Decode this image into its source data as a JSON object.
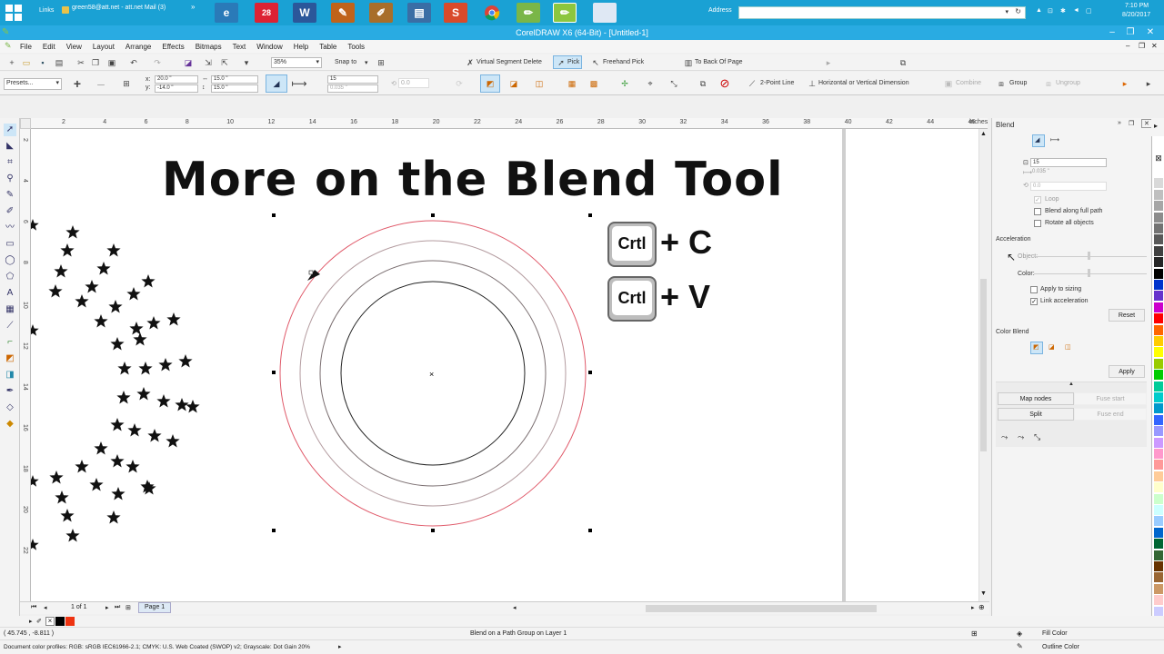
{
  "taskbar": {
    "links_label": "Links",
    "mail_label": "green58@att.net - att.net Mail (3)",
    "address_label": "Address",
    "time": "7:10 PM",
    "date": "8/20/2017"
  },
  "window": {
    "title": "CorelDRAW X6 (64-Bit) - [Untitled-1]"
  },
  "menu": [
    "File",
    "Edit",
    "View",
    "Layout",
    "Arrange",
    "Effects",
    "Bitmaps",
    "Text",
    "Window",
    "Help",
    "Table",
    "Tools"
  ],
  "toolbar": {
    "zoom": "35%",
    "snap_to": "Snap to",
    "virtual_segment_delete": "Virtual Segment Delete",
    "pick": "Pick",
    "freehand_pick": "Freehand Pick",
    "to_back_of_page": "To Back Of Page"
  },
  "property_bar": {
    "presets": "Presets...",
    "x": "20.0 \"",
    "y": "-14.0 \"",
    "width": "15.0 \"",
    "height": "15.0 \"",
    "steps": "15",
    "spacing": "0.035 \"",
    "angle": "0.0",
    "two_point_line": "2-Point Line",
    "horiz_vert_dimension": "Horizontal or Vertical Dimension",
    "combine": "Combine",
    "group": "Group",
    "ungroup": "Ungroup"
  },
  "rulers": {
    "h_ticks": [
      "2",
      "4",
      "6",
      "8",
      "10",
      "12",
      "14",
      "16",
      "18",
      "20",
      "22",
      "24",
      "26",
      "28",
      "30",
      "32",
      "34",
      "36",
      "38",
      "40",
      "42",
      "44",
      "46"
    ],
    "h_unit": "inches",
    "v_ticks": [
      "2",
      "4",
      "6",
      "8",
      "10",
      "12",
      "14",
      "16",
      "18",
      "20",
      "22"
    ]
  },
  "canvas": {
    "title": "More on the Blend Tool",
    "shortcut1_key": "Crtl",
    "shortcut1_plus": "+ C",
    "shortcut2_key": "Crtl",
    "shortcut2_plus": "+ V"
  },
  "docker": {
    "title": "Blend",
    "steps": "15",
    "spacing": "0.035 \"",
    "rotation": "0.0",
    "loop": "Loop",
    "blend_along_full_path": "Blend along full path",
    "rotate_all_objects": "Rotate all objects",
    "acceleration_label": "Acceleration",
    "object_label": "Object:",
    "color_label": "Color:",
    "apply_to_sizing": "Apply to sizing",
    "link_acceleration": "Link acceleration",
    "reset": "Reset",
    "color_blend": "Color Blend",
    "apply": "Apply",
    "map_nodes": "Map nodes",
    "fuse_start": "Fuse start",
    "split": "Split",
    "fuse_end": "Fuse end"
  },
  "status": {
    "page_count": "1 of 1",
    "page_tab": "Page 1",
    "coords": "( 45.745 , -8.811 )",
    "object_info": "Blend on a Path Group on Layer 1",
    "color_profiles": "Document color profiles: RGB: sRGB IEC61966-2.1; CMYK: U.S. Web Coated (SWOP) v2; Grayscale: Dot Gain 20%",
    "fill_color": "Fill Color",
    "outline_color": "Outline Color"
  },
  "palette_colors": [
    "#ffffff",
    "#d9d9d9",
    "#bfbfbf",
    "#a6a6a6",
    "#8c8c8c",
    "#737373",
    "#595959",
    "#404040",
    "#262626",
    "#000000",
    "#0033cc",
    "#6633cc",
    "#cc00cc",
    "#ff0000",
    "#ff6600",
    "#ffcc00",
    "#ffff00",
    "#99cc00",
    "#00cc00",
    "#00cc99",
    "#00cccc",
    "#0099cc",
    "#3366ff",
    "#9999ff",
    "#cc99ff",
    "#ff99cc",
    "#ff9999",
    "#ffcc99",
    "#ffffcc",
    "#ccffcc",
    "#ccffff",
    "#99ccff",
    "#0066cc",
    "#006633",
    "#336633",
    "#663300",
    "#996633",
    "#cc9966",
    "#ffcccc",
    "#ccccff",
    "#e6e6e6"
  ]
}
